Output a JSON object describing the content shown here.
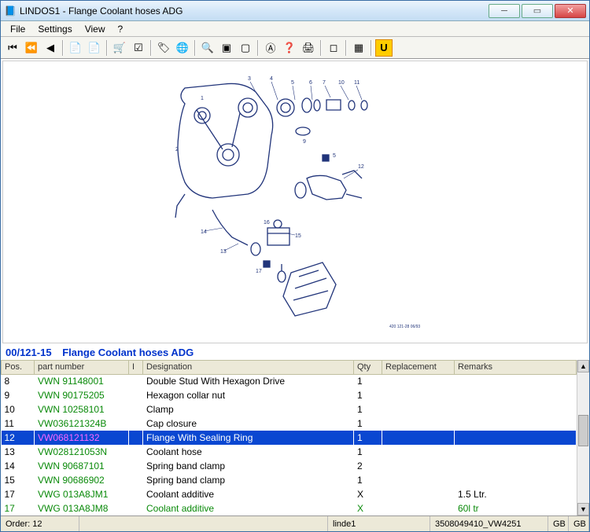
{
  "window": {
    "title": "LINDOS1 - Flange Coolant hoses ADG"
  },
  "menu": [
    "File",
    "Settings",
    "View",
    "?"
  ],
  "toolbar": [
    {
      "name": "first-icon",
      "g": "⏮"
    },
    {
      "name": "rewind-icon",
      "g": "⏪"
    },
    {
      "name": "back-icon",
      "g": "◀"
    },
    {
      "sep": true
    },
    {
      "name": "doc-left-icon",
      "g": "📄"
    },
    {
      "name": "doc-right-icon",
      "g": "📄"
    },
    {
      "sep": true
    },
    {
      "name": "cart-icon",
      "g": "🛒"
    },
    {
      "name": "check-icon",
      "g": "☑"
    },
    {
      "sep": true
    },
    {
      "name": "tag-icon",
      "g": "🏷"
    },
    {
      "name": "globe-icon",
      "g": "🌐"
    },
    {
      "sep": true
    },
    {
      "name": "zoom-icon",
      "g": "🔍"
    },
    {
      "name": "box1-icon",
      "g": "▣"
    },
    {
      "name": "box2-icon",
      "g": "▢"
    },
    {
      "sep": true
    },
    {
      "name": "a-icon",
      "g": "Ⓐ"
    },
    {
      "name": "q-icon",
      "g": "❓"
    },
    {
      "name": "print-icon",
      "g": "🖨"
    },
    {
      "sep": true
    },
    {
      "name": "square-icon",
      "g": "◻"
    },
    {
      "sep": true
    },
    {
      "name": "flag-icon",
      "g": "▦"
    },
    {
      "sep": true
    },
    {
      "name": "u-icon",
      "g": "U",
      "style": "background:#ffcc00;border:1px solid #d80;font-weight:bold;"
    }
  ],
  "section": {
    "code": "00/121-15",
    "name": "Flange Coolant hoses ADG"
  },
  "columns": [
    "Pos.",
    "part number",
    "I",
    "Designation",
    "Qty",
    "Replacement",
    "Remarks"
  ],
  "rows": [
    {
      "pos": "8",
      "pn": "VWN  91148001",
      "i": "",
      "des": "Double Stud With Hexagon Drive",
      "qty": "1",
      "rep": "",
      "rem": ""
    },
    {
      "pos": "9",
      "pn": "VWN  90175205",
      "i": "",
      "des": "Hexagon collar nut",
      "qty": "1",
      "rep": "",
      "rem": ""
    },
    {
      "pos": "10",
      "pn": "VWN  10258101",
      "i": "",
      "des": "Clamp",
      "qty": "1",
      "rep": "",
      "rem": ""
    },
    {
      "pos": "11",
      "pn": "VW036121324B",
      "i": "",
      "des": "Cap closure",
      "qty": "1",
      "rep": "",
      "rem": ""
    },
    {
      "pos": "12",
      "pn": "VW068121132",
      "i": "",
      "des": "Flange With Sealing Ring",
      "qty": "1",
      "rep": "",
      "rem": "",
      "sel": true
    },
    {
      "pos": "13",
      "pn": "VW028121053N",
      "i": "",
      "des": "Coolant hose",
      "qty": "1",
      "rep": "",
      "rem": ""
    },
    {
      "pos": "14",
      "pn": "VWN  90687101",
      "i": "",
      "des": "Spring band clamp",
      "qty": "2",
      "rep": "",
      "rem": ""
    },
    {
      "pos": "15",
      "pn": "VWN  90686902",
      "i": "",
      "des": "Spring band clamp",
      "qty": "1",
      "rep": "",
      "rem": ""
    },
    {
      "pos": "17",
      "pn": "VWG  013A8JM1",
      "i": "",
      "des": "Coolant additive",
      "qty": "X",
      "rep": "",
      "rem": "1.5 Ltr."
    },
    {
      "pos": "17",
      "pn": "VWG  013A8JM8",
      "i": "",
      "des": "Coolant additive",
      "qty": "X",
      "rep": "",
      "rem": "60l tr",
      "cut": true
    }
  ],
  "status": {
    "order": "Order: 12",
    "user": "linde1",
    "doc": "3508049410_VW4251",
    "lang1": "GB",
    "lang2": "GB"
  }
}
